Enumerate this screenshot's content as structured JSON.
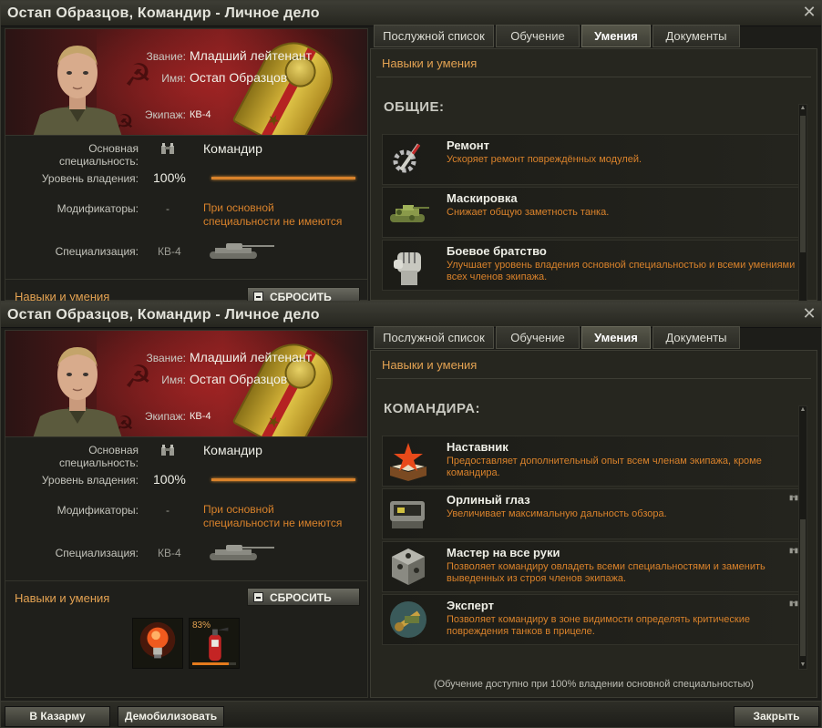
{
  "window_title": "Остап Образцов, Командир - Личное дело",
  "close_symbol": "✕",
  "personal": {
    "rank_label": "Звание:",
    "rank": "Младший лейтенант",
    "name_label": "Имя:",
    "name": "Остап Образцов",
    "crew_label": "Экипаж:",
    "crew": "КВ-4"
  },
  "stats": {
    "specialty_label": "Основная специальность:",
    "specialty": "Командир",
    "proficiency_label": "Уровень владения:",
    "proficiency": "100%",
    "proficiency_value": 100,
    "modifiers_label": "Модификаторы:",
    "modifiers_dash": "-",
    "modifiers_note": "При основной специальности не имеются",
    "specialization_label": "Специализация:",
    "specialization": "КВ-4"
  },
  "skills_section": {
    "title": "Навыки и умения",
    "reset_label": "СБРОСИТЬ",
    "slots": [
      {
        "icon": "lightbulb-icon"
      },
      {
        "icon": "fire-extinguisher-icon",
        "percent": "83%",
        "progress": 0.83
      }
    ]
  },
  "tabs": [
    "Послужной список",
    "Обучение",
    "Умения",
    "Документы"
  ],
  "active_tab": "Умения",
  "panel": {
    "subtitle": "Навыки и умения",
    "general": {
      "category": "ОБЩИЕ:",
      "skills": [
        {
          "name": "Ремонт",
          "desc": "Ускоряет ремонт повреждённых модулей.",
          "icon": "repair-tools-icon"
        },
        {
          "name": "Маскировка",
          "desc": "Снижает общую заметность танка.",
          "icon": "camouflage-tank-icon"
        },
        {
          "name": "Боевое братство",
          "desc": "Улучшает уровень владения основной специальностью и всеми умениями всех членов экипажа.",
          "icon": "fist-icon"
        }
      ]
    },
    "commander": {
      "category": "КОМАНДИРА:",
      "skills": [
        {
          "name": "Наставник",
          "desc": "Предоставляет дополнительный опыт всем членам экипажа, кроме командира.",
          "icon": "book-star-icon"
        },
        {
          "name": "Орлиный глаз",
          "desc": "Увеличивает максимальную дальность обзора.",
          "icon": "periscope-icon"
        },
        {
          "name": "Мастер на все руки",
          "desc": "Позволяет командиру овладеть всеми специальностями и заменить выведенных из строя членов экипажа.",
          "icon": "cube-icon"
        },
        {
          "name": "Эксперт",
          "desc": "Позволяет командиру в зоне видимости определять критические повреждения танков в прицеле.",
          "icon": "wrench-shield-icon"
        }
      ]
    },
    "note": "(Обучение доступно при 100% владении основной специальностью)"
  },
  "footer": {
    "barracks": "В Казарму",
    "demobilize": "Демобилизовать",
    "close": "Закрыть"
  },
  "colors": {
    "accent": "#d9822b",
    "heading": "#e3a252"
  }
}
